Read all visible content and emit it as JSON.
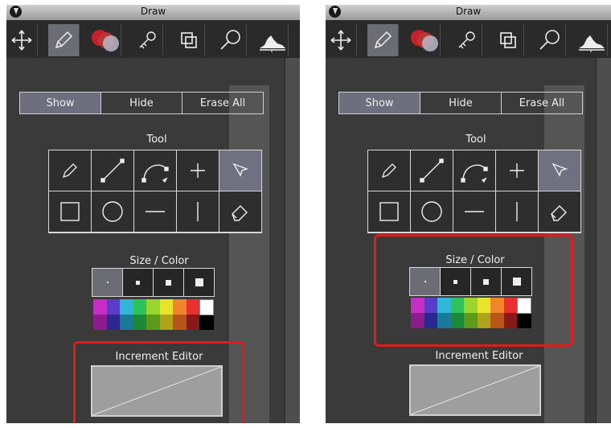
{
  "panels": [
    {
      "title": "Draw",
      "toolbar_icons": [
        "move-icon",
        "pencil-icon",
        "color-circles-icon",
        "key-icon",
        "layers-icon",
        "magnify-icon",
        "histogram-icon"
      ],
      "segment": [
        "Show",
        "Hide",
        "Erase All"
      ],
      "tool_label": "Tool",
      "size_color_label": "Size / Color",
      "increment_label": "Increment Editor"
    },
    {
      "title": "Draw",
      "toolbar_icons": [
        "move-icon",
        "pencil-icon",
        "color-circles-icon",
        "key-icon",
        "layers-icon",
        "magnify-icon",
        "histogram-icon"
      ],
      "segment": [
        "Show",
        "Hide",
        "Erase All"
      ],
      "tool_label": "Tool",
      "size_color_label": "Size / Color",
      "increment_label": "Increment Editor"
    }
  ],
  "colors": {
    "highlight": "#e31b1b",
    "palette_top": [
      "#c62ec6",
      "#5a3cc8",
      "#32b6d8",
      "#2ec25a",
      "#9ad42e",
      "#e8e42e",
      "#f0862a",
      "#e83030",
      "#ffffff"
    ],
    "palette_bottom": [
      "#8a1c8c",
      "#2a2890",
      "#1a7a9a",
      "#1a8a3a",
      "#5c9a1a",
      "#b0a21a",
      "#b8561a",
      "#8a1a1a",
      "#000000"
    ]
  }
}
